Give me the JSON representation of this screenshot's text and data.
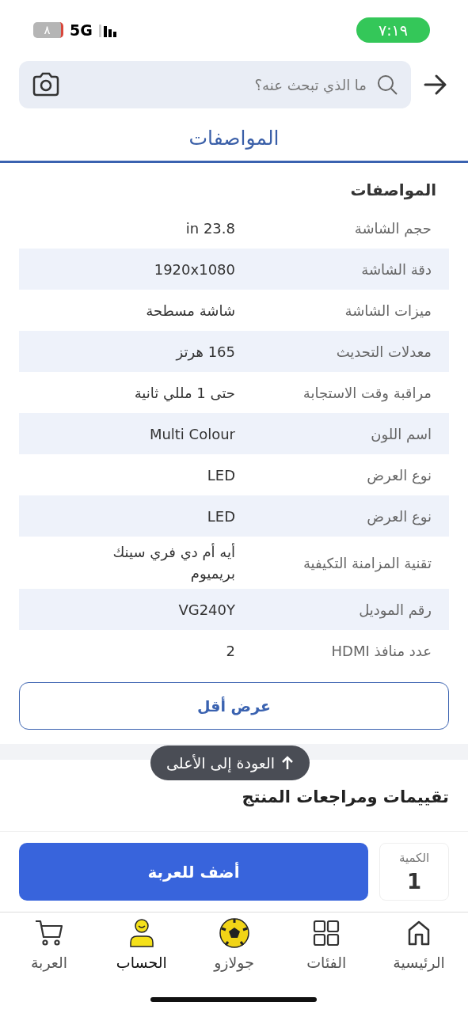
{
  "status_bar": {
    "time": "٧:١٩",
    "network": "5G",
    "battery": "٨"
  },
  "search": {
    "placeholder": "ما الذي تبحث عنه؟"
  },
  "tabs": [
    {
      "label": "المواصفات",
      "selected": true
    }
  ],
  "specs": {
    "title": "المواصفات",
    "rows": [
      {
        "label": "حجم الشاشة",
        "value": "23.8 in"
      },
      {
        "label": "دقة الشاشة",
        "value": "1920x1080"
      },
      {
        "label": "ميزات الشاشة",
        "value": "شاشة مسطحة"
      },
      {
        "label": "معدلات التحديث",
        "value": "165 هرتز"
      },
      {
        "label": "مراقبة وقت الاستجابة",
        "value": "حتى 1 مللي ثانية"
      },
      {
        "label": "اسم اللون",
        "value": "Multi Colour"
      },
      {
        "label": "نوع العرض",
        "value": "LED"
      },
      {
        "label": "نوع العرض",
        "value": "LED"
      },
      {
        "label": "تقنية المزامنة التكيفية",
        "value": "أيه أم دي فري سينك بريميوم"
      },
      {
        "label": "رقم الموديل",
        "value": "VG240Y"
      },
      {
        "label": "عدد منافذ HDMI",
        "value": "2"
      }
    ],
    "toggle_button": "عرض أقل"
  },
  "back_to_top": "العودة إلى الأعلى",
  "reviews_heading": "تقييمات ومراجعات المنتج",
  "purchase": {
    "add_button": "أضف للعربة",
    "quantity_label": "الكمية",
    "quantity": "1"
  },
  "nav": [
    {
      "label": "الرئيسية",
      "kind": "home",
      "selected": false
    },
    {
      "label": "الفئات",
      "kind": "grid",
      "selected": false
    },
    {
      "label": "جولازو",
      "kind": "ball",
      "selected": false
    },
    {
      "label": "الحساب",
      "kind": "user",
      "selected": true
    },
    {
      "label": "العربة",
      "kind": "cart",
      "selected": false
    }
  ]
}
